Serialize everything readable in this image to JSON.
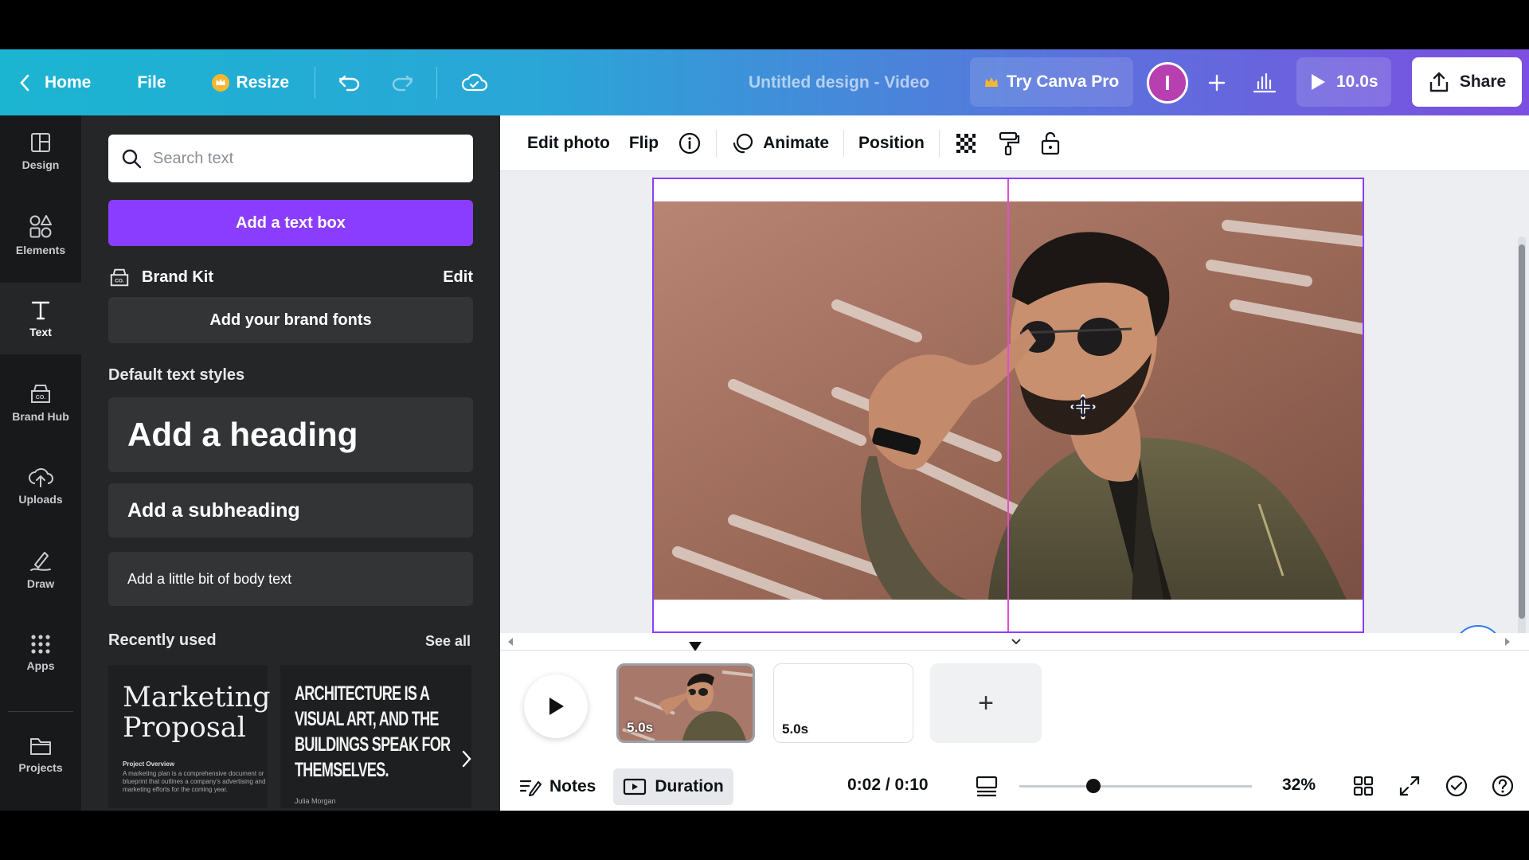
{
  "topbar": {
    "home_label": "Home",
    "file_label": "File",
    "resize_label": "Resize",
    "title": "Untitled design - Video",
    "try_pro_label": "Try Canva Pro",
    "avatar_initial": "I",
    "play_duration": "10.0s",
    "share_label": "Share",
    "resize_icon_color": "#f7b731"
  },
  "rail": {
    "items": [
      {
        "label": "Design",
        "icon": "layout-icon"
      },
      {
        "label": "Elements",
        "icon": "shapes-icon"
      },
      {
        "label": "Text",
        "icon": "text-icon"
      },
      {
        "label": "Brand Hub",
        "icon": "brand-hub-icon"
      },
      {
        "label": "Uploads",
        "icon": "cloud-upload-icon"
      },
      {
        "label": "Draw",
        "icon": "pen-icon"
      },
      {
        "label": "Apps",
        "icon": "apps-grid-icon"
      },
      {
        "label": "Projects",
        "icon": "folder-icon"
      }
    ],
    "active": "Text"
  },
  "panel": {
    "search_placeholder": "Search text",
    "add_text_box": "Add a text box",
    "brand_kit_label": "Brand Kit",
    "brand_kit_edit": "Edit",
    "add_brand_fonts": "Add your brand fonts",
    "default_styles_title": "Default text styles",
    "heading": "Add a heading",
    "subheading": "Add a subheading",
    "body_text": "Add a little bit of body text",
    "recently_used_title": "Recently used",
    "see_all": "See all",
    "recent": [
      {
        "title_line1": "Marketing",
        "title_line2": "Proposal",
        "sub_heading": "Project Overview",
        "sub_text": "A marketing plan is a comprehensive document or blueprint that outlines a company's advertising and marketing efforts for the coming year."
      },
      {
        "lines": [
          "ARCHITECTURE IS A",
          "VISUAL ART, AND THE",
          "BUILDINGS SPEAK FOR",
          "THEMSELVES."
        ],
        "author": "Julia Morgan"
      }
    ],
    "accent_color": "#8b3dff"
  },
  "toolbar": {
    "edit_photo": "Edit photo",
    "flip": "Flip",
    "animate": "Animate",
    "position": "Position"
  },
  "timeline": {
    "clips": [
      {
        "duration": "5.0s"
      },
      {
        "duration": "5.0s"
      }
    ],
    "add_clip": "+"
  },
  "bottombar": {
    "notes_label": "Notes",
    "duration_label": "Duration",
    "time": "0:02 / 0:10",
    "zoom": "32%",
    "zoom_fraction": 0.32
  }
}
